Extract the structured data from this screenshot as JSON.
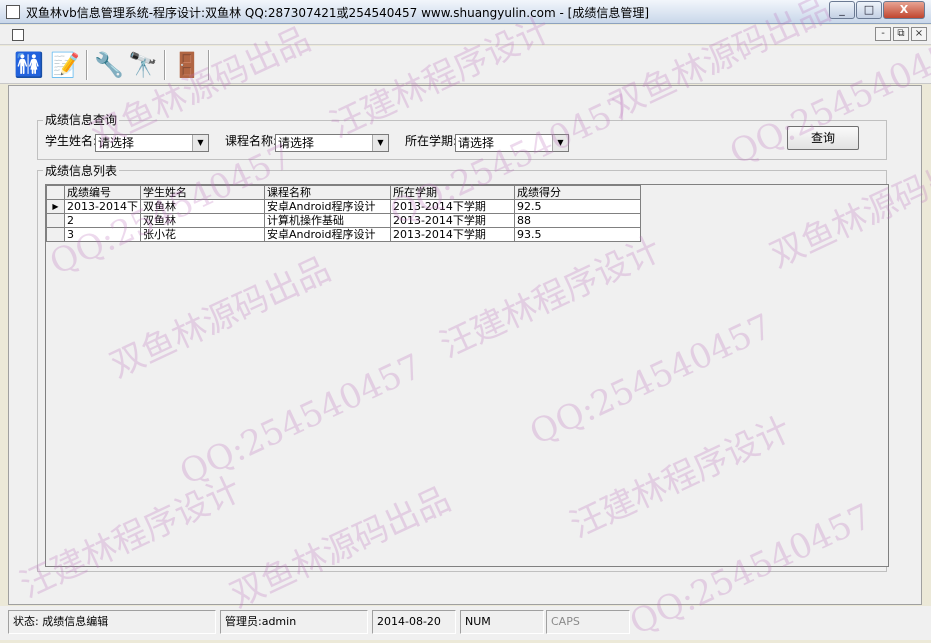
{
  "window": {
    "title": "双鱼林vb信息管理系统-程序设计:双鱼林 QQ:287307421或254540457 www.shuangyulin.com - [成绩信息管理]",
    "minimize": "_",
    "maximize": "□",
    "close": "X"
  },
  "mdi": {
    "minimize": "-",
    "restore": "⧉",
    "close": "×"
  },
  "toolbar": {
    "students_icon": "🚻",
    "edit_icon": "📝",
    "settings_icon": "🔧",
    "search_icon": "🔭",
    "exit_icon": "🚪"
  },
  "query": {
    "group_title": "成绩信息查询",
    "student_label": "学生姓名:",
    "student_value": "请选择",
    "course_label": "课程名称:",
    "course_value": "请选择",
    "term_label": "所在学期:",
    "term_value": "请选择",
    "button": "查询"
  },
  "list": {
    "group_title": "成绩信息列表",
    "columns": [
      "成绩编号",
      "学生姓名",
      "课程名称",
      "所在学期",
      "成绩得分"
    ],
    "rows": [
      [
        "2013-2014下",
        "双鱼林",
        "安卓Android程序设计",
        "2013-2014下学期",
        "92.5"
      ],
      [
        "2",
        "双鱼林",
        "计算机操作基础",
        "2013-2014下学期",
        "88"
      ],
      [
        "3",
        "张小花",
        "安卓Android程序设计",
        "2013-2014下学期",
        "93.5"
      ]
    ],
    "row_indicator": "▶"
  },
  "status": {
    "state": "状态:  成绩信息编辑",
    "admin": "管理员:admin",
    "date": "2014-08-20",
    "num": "NUM",
    "caps": "CAPS"
  },
  "watermarks": {
    "a": "双鱼林源码出品",
    "b": "汪建林程序设计",
    "c": "QQ:254540457"
  }
}
